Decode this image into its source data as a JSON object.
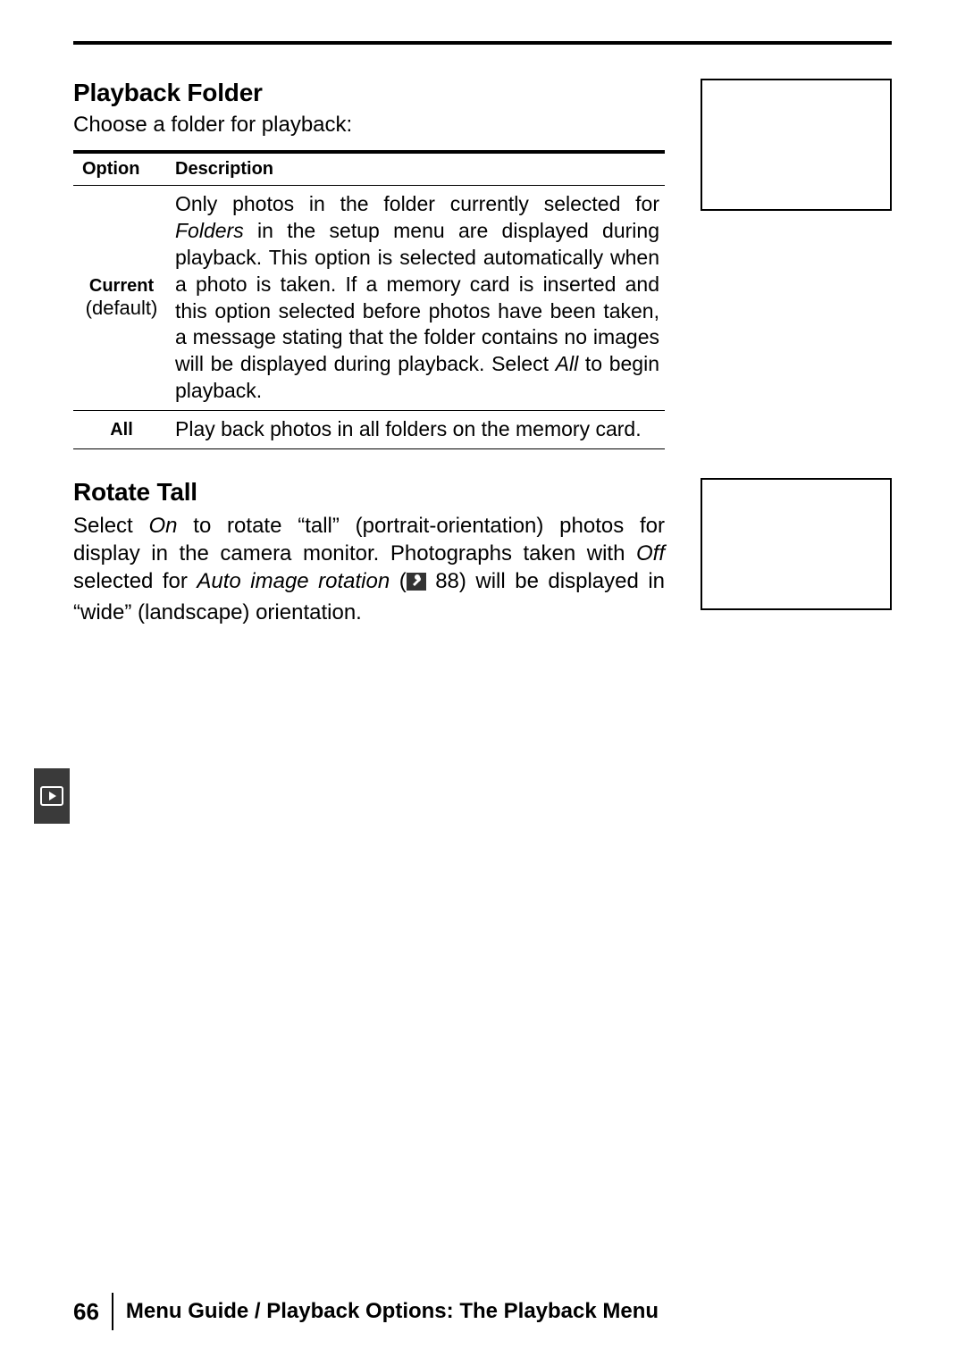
{
  "section1": {
    "heading": "Playback Folder",
    "intro": "Choose a folder for playback:",
    "table": {
      "headers": {
        "option": "Option",
        "description": "Description"
      },
      "rows": [
        {
          "option_bold": "Current",
          "option_sub": "(default)",
          "desc_pre": "Only photos in the folder currently selected for ",
          "desc_em1": "Folders",
          "desc_mid": " in the setup menu are displayed during playback.  This option is selected automatically when a photo is taken.  If a memory card is inserted and this option selected before photos have been taken, a message stating that the folder contains no images will be displayed during playback.  Select ",
          "desc_em2": "All",
          "desc_post": " to begin playback."
        },
        {
          "option_bold": "All",
          "option_sub": "",
          "desc_plain": "Play back photos in all folders on the memory card."
        }
      ]
    }
  },
  "section2": {
    "heading": "Rotate Tall",
    "para": {
      "t1": "Select ",
      "em1": "On",
      "t2": " to rotate “tall” (portrait-orientation) photos for display in the camera monitor.  Photographs taken with ",
      "em2": "Off",
      "t3": " selected for ",
      "em3": "Auto image rotation",
      "t4": " (",
      "page_ref": " 88) will be displayed in “wide” (land­scape) orientation."
    }
  },
  "footer": {
    "page_number": "66",
    "title": "Menu Guide / Playback Options: The Playback Menu"
  }
}
